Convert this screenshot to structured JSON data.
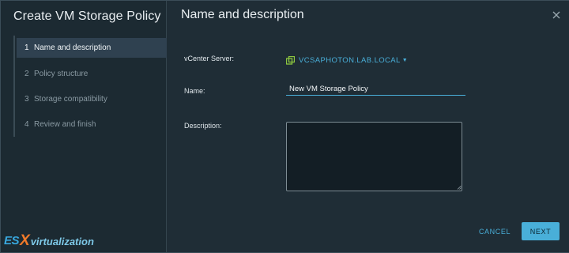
{
  "wizard": {
    "title": "Create VM Storage Policy",
    "steps": [
      {
        "num": "1",
        "label": "Name and description",
        "active": true
      },
      {
        "num": "2",
        "label": "Policy structure",
        "active": false
      },
      {
        "num": "3",
        "label": "Storage compatibility",
        "active": false
      },
      {
        "num": "4",
        "label": "Review and finish",
        "active": false
      }
    ]
  },
  "watermark": {
    "part1": "ES",
    "part2": "X",
    "part3": "virtualization"
  },
  "page": {
    "title": "Name and description",
    "vcenter_label": "vCenter Server:",
    "vcenter_value": "VCSAPHOTON.LAB.LOCAL",
    "name_label": "Name:",
    "name_value": "New VM Storage Policy",
    "description_label": "Description:",
    "description_value": ""
  },
  "footer": {
    "cancel_label": "CANCEL",
    "next_label": "NEXT"
  },
  "colors": {
    "accent": "#49afd9",
    "vcenter_icon": "#8cc63f"
  }
}
